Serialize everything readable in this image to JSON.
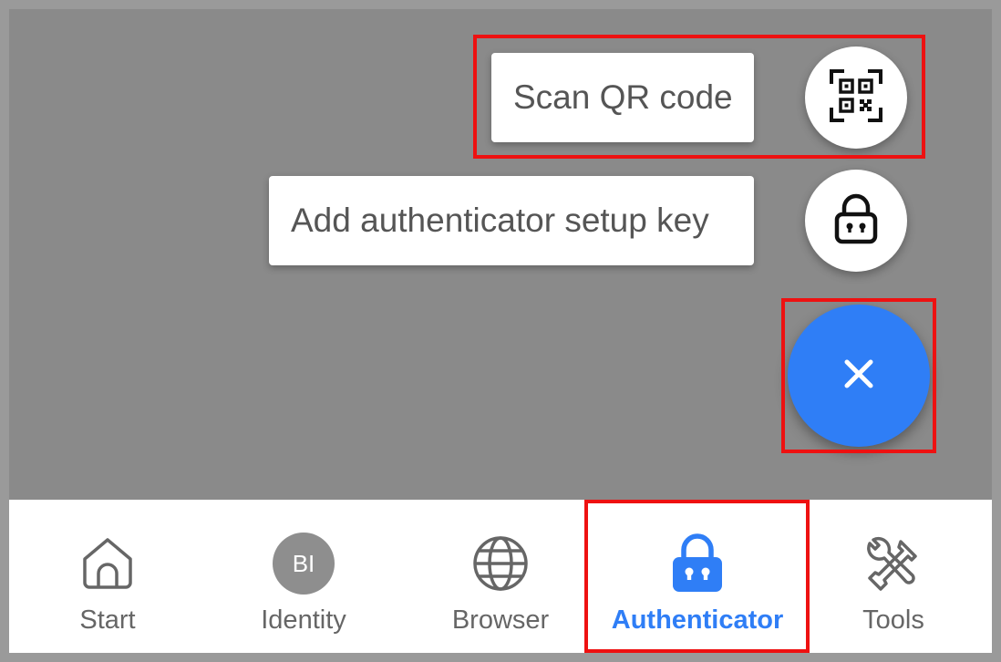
{
  "speed_dial": {
    "scan_qr_label": "Scan QR code",
    "scan_qr_icon": "qr-code-icon",
    "setup_key_label": "Add authenticator setup key",
    "setup_key_icon": "lock-icon",
    "close_icon": "close-icon"
  },
  "bottom_nav": {
    "items": [
      {
        "label": "Start",
        "icon": "home-icon"
      },
      {
        "label": "Identity",
        "icon": "avatar",
        "avatar_initials": "BI"
      },
      {
        "label": "Browser",
        "icon": "globe-icon"
      },
      {
        "label": "Authenticator",
        "icon": "lock-icon",
        "active": true
      },
      {
        "label": "Tools",
        "icon": "tools-icon"
      }
    ]
  },
  "colors": {
    "accent": "#2f7ef6",
    "highlight": "#ee1111",
    "scrim": "#8a8a8a",
    "inactive_text": "#666666"
  }
}
